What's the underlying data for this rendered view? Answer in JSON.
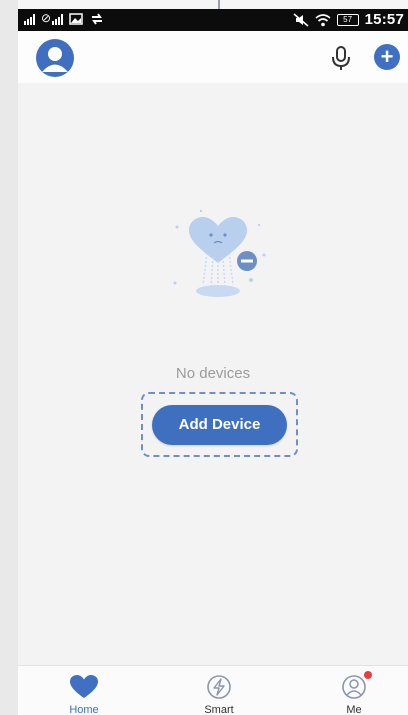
{
  "status_bar": {
    "time": "15:57",
    "battery": "57",
    "left_icons": [
      "signal-icon",
      "no-sim-signal-icon",
      "image-notification-icon",
      "sync-icon"
    ],
    "right_icons": [
      "vibrate-mute-icon",
      "wifi-icon",
      "battery-icon"
    ]
  },
  "header": {
    "icons": [
      "avatar-icon",
      "microphone-icon",
      "add-icon"
    ],
    "add_symbol": "+"
  },
  "empty_state": {
    "illustration": "no-devices-heart-illustration",
    "message": "No devices",
    "button_label": "Add Device"
  },
  "tabs": [
    {
      "label": "Home",
      "icon": "heart-icon",
      "active": true
    },
    {
      "label": "Smart",
      "icon": "lightning-icon",
      "active": false
    },
    {
      "label": "Me",
      "icon": "person-icon",
      "active": false,
      "badge": true
    }
  ],
  "colors": {
    "accent": "#3f70c1",
    "background": "#f3f3f4",
    "badge": "#ee3b3b"
  }
}
